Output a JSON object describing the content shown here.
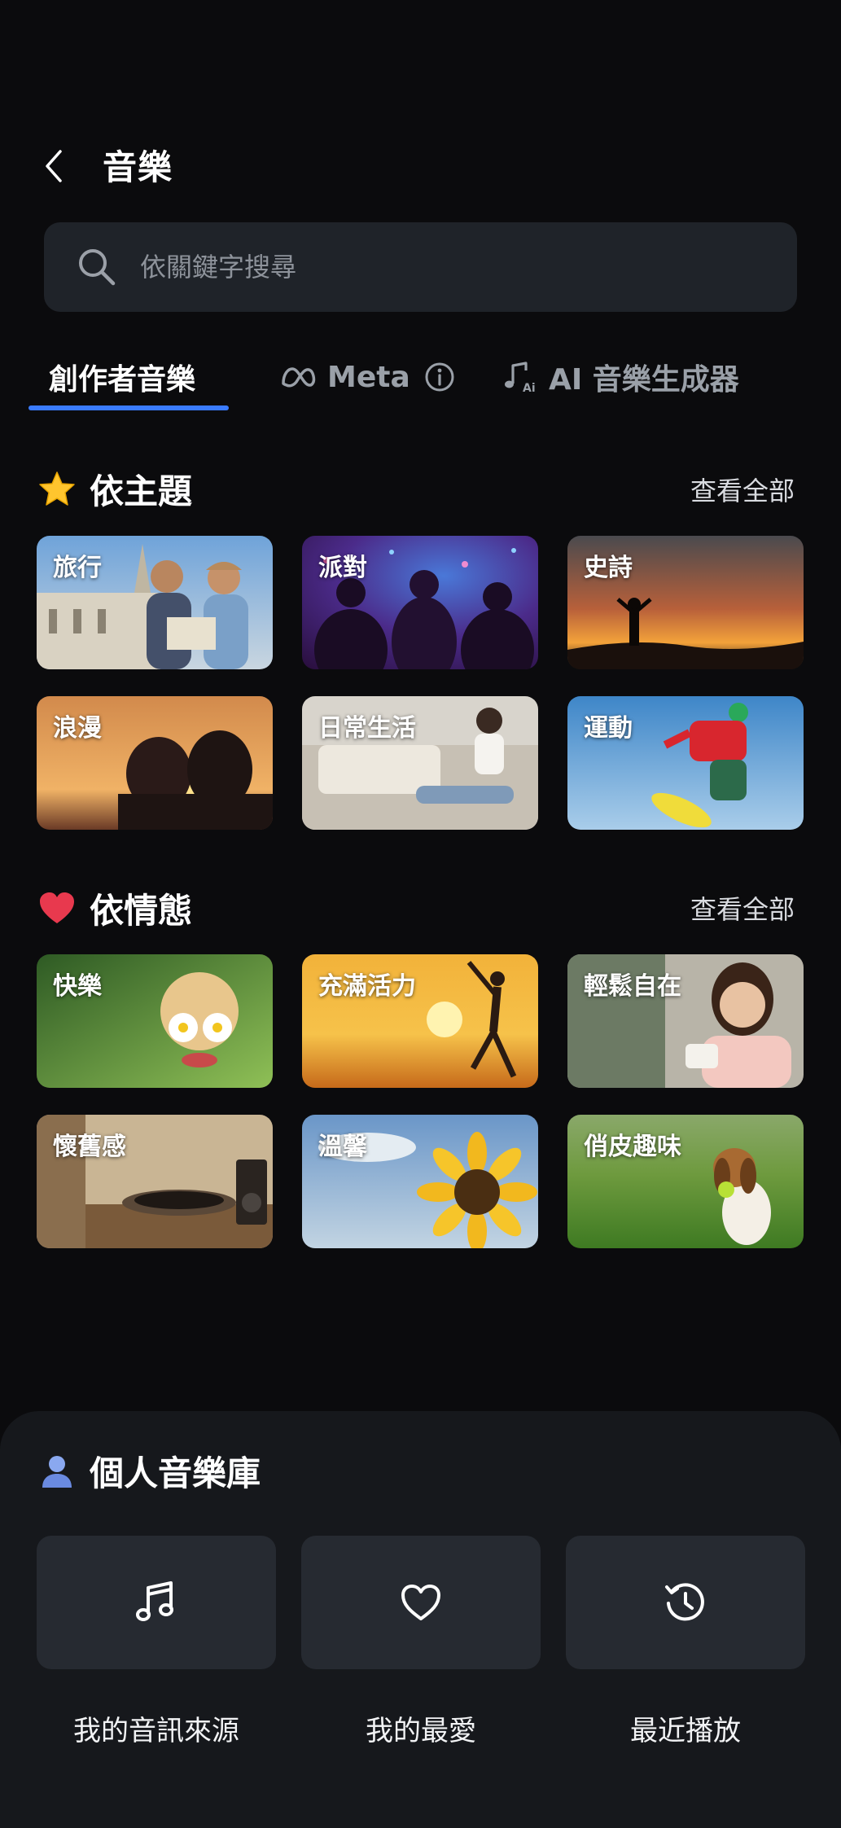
{
  "header": {
    "title": "音樂"
  },
  "search": {
    "placeholder": "依關鍵字搜尋"
  },
  "tabs": [
    {
      "label": "創作者音樂",
      "active": true
    },
    {
      "label": "Meta",
      "active": false
    },
    {
      "label": "AI 音樂生成器",
      "active": false
    }
  ],
  "themes": {
    "title": "依主題",
    "view_all": "查看全部",
    "items": [
      {
        "label": "旅行"
      },
      {
        "label": "派對"
      },
      {
        "label": "史詩"
      },
      {
        "label": "浪漫"
      },
      {
        "label": "日常生活"
      },
      {
        "label": "運動"
      }
    ]
  },
  "moods": {
    "title": "依情態",
    "view_all": "查看全部",
    "items": [
      {
        "label": "快樂"
      },
      {
        "label": "充滿活力"
      },
      {
        "label": "輕鬆自在"
      },
      {
        "label": "懷舊感"
      },
      {
        "label": "溫馨"
      },
      {
        "label": "俏皮趣味"
      }
    ]
  },
  "library": {
    "title": "個人音樂庫",
    "items": [
      {
        "label": "我的音訊來源",
        "icon": "music-note-icon"
      },
      {
        "label": "我的最愛",
        "icon": "heart-icon"
      },
      {
        "label": "最近播放",
        "icon": "history-icon"
      }
    ]
  },
  "colors": {
    "background": "#0b0b0d",
    "accent": "#3a7bff",
    "surface": "#1f2329"
  }
}
